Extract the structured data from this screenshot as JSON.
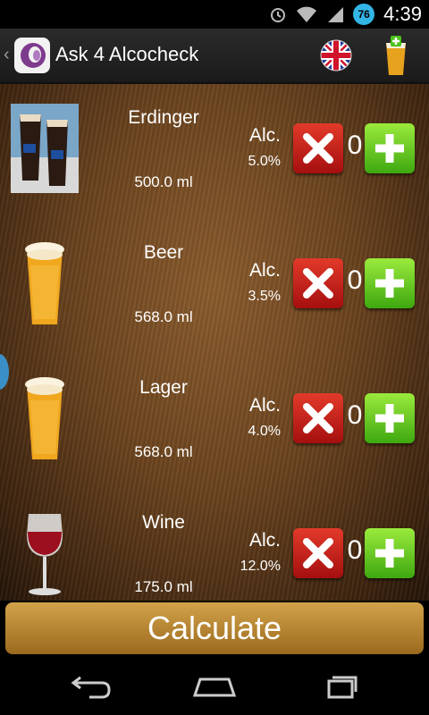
{
  "status_bar": {
    "time": "4:39",
    "battery_level": "76"
  },
  "action_bar": {
    "back_icon": "chevron-left-icon",
    "title": "Ask 4 Alcocheck",
    "language_icon": "uk-flag-icon",
    "add_drink_icon": "beer-add-icon"
  },
  "drinks": [
    {
      "name": "Erdinger",
      "volume": "500.0 ml",
      "alc_label": "Alc.",
      "alc_value": "5.0%",
      "count": "0",
      "image": "erdinger-glasses-photo"
    },
    {
      "name": "Beer",
      "volume": "568.0 ml",
      "alc_label": "Alc.",
      "alc_value": "3.5%",
      "count": "0",
      "image": "beer-pint-icon"
    },
    {
      "name": "Lager",
      "volume": "568.0 ml",
      "alc_label": "Alc.",
      "alc_value": "4.0%",
      "count": "0",
      "image": "beer-pint-icon"
    },
    {
      "name": "Wine",
      "volume": "175.0 ml",
      "alc_label": "Alc.",
      "alc_value": "12.0%",
      "count": "0",
      "image": "wine-glass-icon"
    }
  ],
  "calculate_label": "Calculate",
  "colors": {
    "remove": "#c0160f",
    "add": "#5fc61a",
    "calculate": "#b8852f",
    "accent": "#33b5e5"
  }
}
